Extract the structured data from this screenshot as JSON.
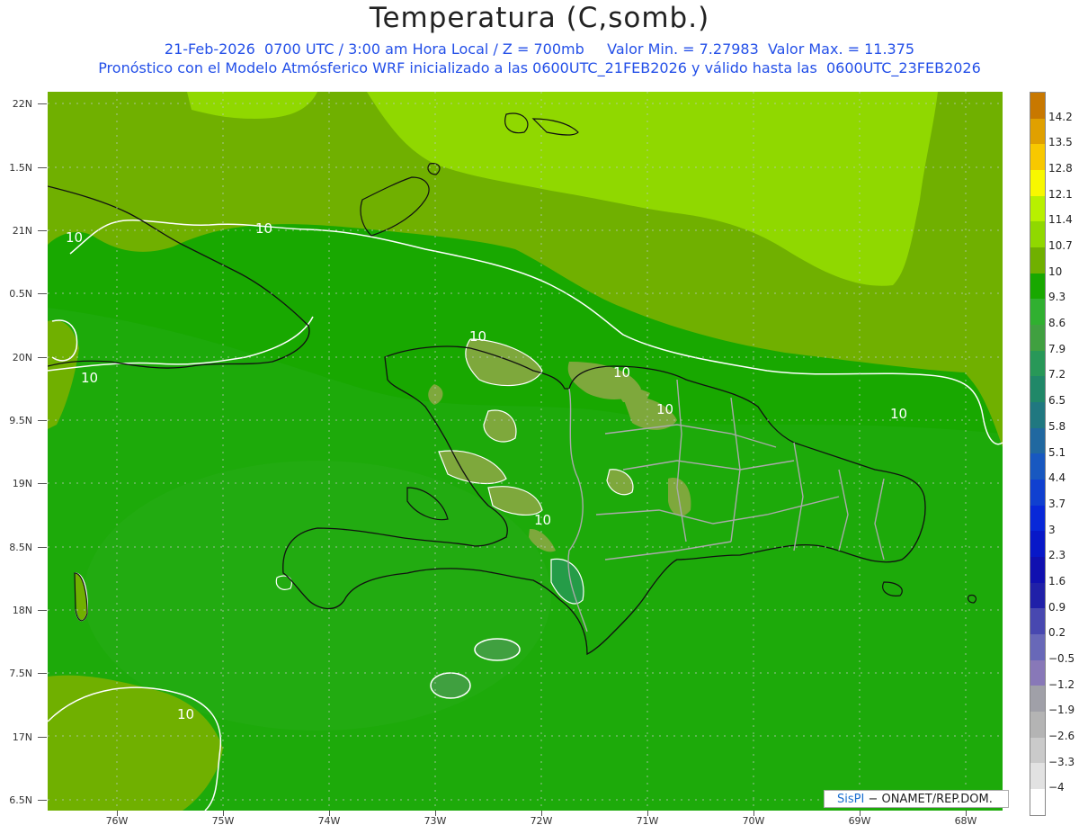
{
  "header": {
    "title": "Temperatura (C,somb.)",
    "line1": "21-Feb-2026  0700 UTC / 3:00 am Hora Local / Z = 700mb     Valor Min. = 7.27983  Valor Max. = 11.375",
    "line2": "Pronóstico con el Modelo Atmósferico WRF inicializado a las 0600UTC_21FEB2026 y válido hasta las  0600UTC_23FEB2026"
  },
  "axes": {
    "lat_labels": [
      "22N",
      "1.5N",
      "21N",
      "0.5N",
      "20N",
      "9.5N",
      "19N",
      "8.5N",
      "18N",
      "7.5N",
      "17N",
      "6.5N"
    ],
    "lon_labels": [
      "76W",
      "75W",
      "74W",
      "73W",
      "72W",
      "71W",
      "70W",
      "69W",
      "68W"
    ]
  },
  "colorbar": {
    "labels": [
      "14.2",
      "13.5",
      "12.8",
      "12.1",
      "11.4",
      "10.7",
      "10",
      "9.3",
      "8.6",
      "7.9",
      "7.2",
      "6.5",
      "5.8",
      "5.1",
      "4.4",
      "3.7",
      "3",
      "2.3",
      "1.6",
      "0.9",
      "0.2",
      "−0.5",
      "−1.2",
      "−1.9",
      "−2.6",
      "−3.3",
      "−4"
    ],
    "colors": [
      "#c87800",
      "#e0a000",
      "#f8c800",
      "#f8f800",
      "#b8f000",
      "#90d800",
      "#70b000",
      "#18a800",
      "#30b030",
      "#40a040",
      "#289858",
      "#208868",
      "#207880",
      "#2068a0",
      "#1858c0",
      "#1040d0",
      "#0828d8",
      "#0818c8",
      "#1010b0",
      "#2020a8",
      "#4848b0",
      "#6868b8",
      "#8878b8",
      "#a0a0a8",
      "#b4b4b4",
      "#cacaca",
      "#e2e2e2",
      "#ffffff"
    ]
  },
  "contour_labels": [
    "10",
    "10",
    "10",
    "10",
    "10",
    "10",
    "10",
    "10",
    "10"
  ],
  "credit": {
    "brand": "SisPI",
    "text": " − ONAMET/REP.DOM."
  }
}
